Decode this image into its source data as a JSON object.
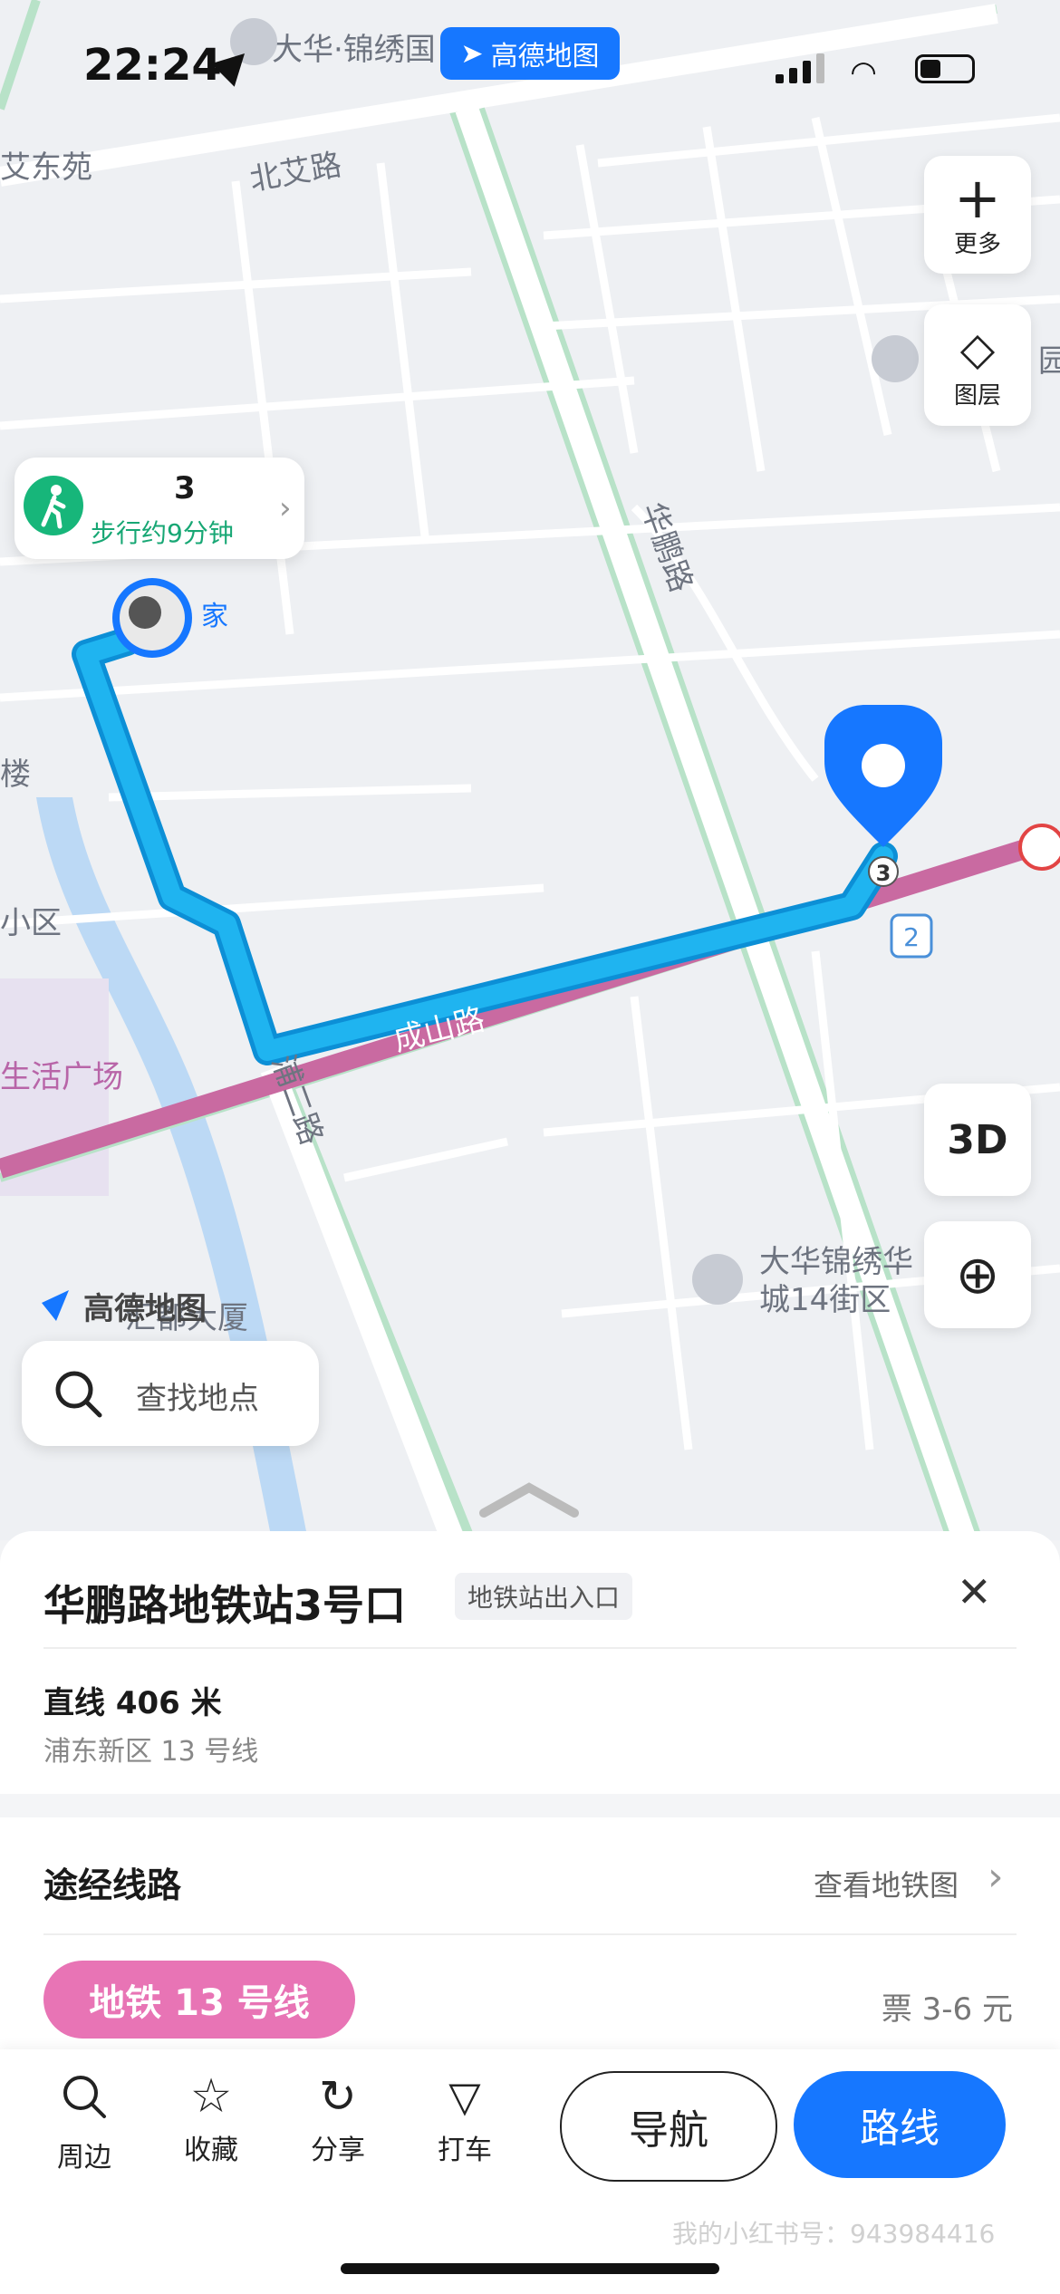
{
  "status_bar": {
    "time": "22:24"
  },
  "map": {
    "app_badge": "高德地图",
    "labels": {
      "district_top": "大华·锦绣国",
      "left_area": "艾东苑",
      "beiai_road": "北艾路",
      "huapeng_road": "华鹏路",
      "chengshan_road": "成山路",
      "puer_road": "浦二路",
      "home": "家",
      "building_left": "楼",
      "area_left": "小区",
      "plaza": "生活广场",
      "tower": "汇都大厦",
      "district_bottom_1": "大华锦绣华",
      "district_bottom_2": "城14街区",
      "edge_label": "园",
      "station_exit": "3",
      "exit_2": "2"
    },
    "logo_text": "高德地图",
    "more_label": "更多",
    "layers_label": "图层",
    "btn_3d": "3D",
    "walk_card": {
      "title": "3",
      "subtitle": "步行约9分钟"
    },
    "search_placeholder": "查找地点"
  },
  "detail": {
    "title": "华鹏路地铁站3号口",
    "tag": "地铁站出入口",
    "distance": "直线 406 米",
    "area": "浦东新区 13 号线",
    "route_label": "途经线路",
    "metro_map_link": "查看地铁图",
    "line_chip": "地铁 13 号线",
    "fare": "票 3-6 元"
  },
  "toolbar": {
    "nearby": "周边",
    "favorite": "收藏",
    "share": "分享",
    "taxi": "打车",
    "navigate": "导航",
    "route": "路线",
    "watermark": "我的小红书号：943984416"
  },
  "colors": {
    "accent": "#1677ff",
    "route": "#1fb4f0",
    "metro_line": "#c96aa1",
    "walk_green": "#17b67a",
    "line_chip": "#e874b5"
  }
}
